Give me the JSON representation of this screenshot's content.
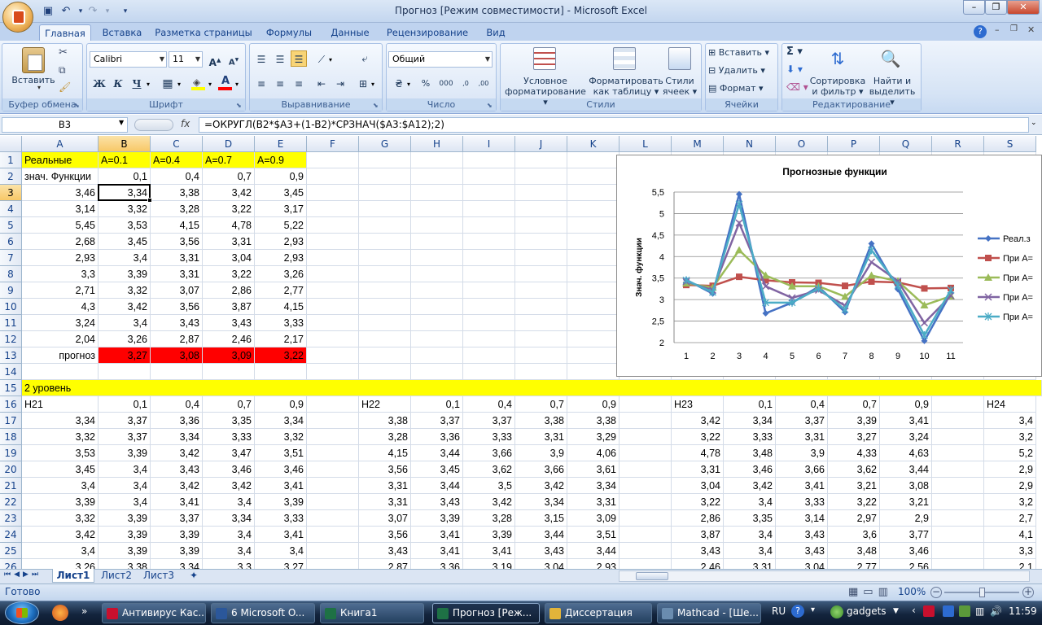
{
  "title": "Прогноз  [Режим совместимости] - Microsoft Excel",
  "ribbon_tabs": [
    "Главная",
    "Вставка",
    "Разметка страницы",
    "Формулы",
    "Данные",
    "Рецензирование",
    "Вид"
  ],
  "groups": {
    "clipboard": {
      "label": "Буфер обмена",
      "paste": "Вставить"
    },
    "font": {
      "label": "Шрифт",
      "name": "Calibri",
      "size": "11"
    },
    "alignment": {
      "label": "Выравнивание"
    },
    "number": {
      "label": "Число",
      "format": "Общий"
    },
    "styles": {
      "label": "Стили",
      "cond1": "Условное",
      "cond2": "форматирование",
      "table1": "Форматировать",
      "table2": "как таблицу",
      "cell1": "Стили",
      "cell2": "ячеек"
    },
    "cells": {
      "label": "Ячейки",
      "insert": "Вставить",
      "delete": "Удалить",
      "format": "Формат"
    },
    "editing": {
      "label": "Редактирование",
      "sort1": "Сортировка",
      "sort2": "и фильтр",
      "find1": "Найти и",
      "find2": "выделить",
      "sigma": "Σ"
    }
  },
  "namebox": "B3",
  "fx": "fx",
  "formula": "=ОКРУГЛ(B2*$A3+(1-B2)*СРЗНАЧ($A3:$A12);2)",
  "columns": [
    "A",
    "B",
    "C",
    "D",
    "E",
    "F",
    "G",
    "H",
    "I",
    "J",
    "K",
    "L",
    "M",
    "N",
    "O",
    "P",
    "Q",
    "R",
    "S"
  ],
  "rows": [
    "1",
    "2",
    "3",
    "4",
    "5",
    "6",
    "7",
    "8",
    "9",
    "10",
    "11",
    "12",
    "13",
    "14",
    "15",
    "16",
    "17",
    "18",
    "19",
    "20",
    "21",
    "22",
    "23",
    "24",
    "25",
    "26"
  ],
  "cells": {
    "r1": [
      "Реальные",
      "A=0.1",
      "A=0.4",
      "A=0.7",
      "A=0.9"
    ],
    "r2": [
      "знач. Функции",
      "0,1",
      "0,4",
      "0,7",
      "0,9"
    ],
    "r3": [
      "3,46",
      "3,34",
      "3,38",
      "3,42",
      "3,45"
    ],
    "r4": [
      "3,14",
      "3,32",
      "3,28",
      "3,22",
      "3,17"
    ],
    "r5": [
      "5,45",
      "3,53",
      "4,15",
      "4,78",
      "5,22"
    ],
    "r6": [
      "2,68",
      "3,45",
      "3,56",
      "3,31",
      "2,93"
    ],
    "r7": [
      "2,93",
      "3,4",
      "3,31",
      "3,04",
      "2,93"
    ],
    "r8": [
      "3,3",
      "3,39",
      "3,31",
      "3,22",
      "3,26"
    ],
    "r9": [
      "2,71",
      "3,32",
      "3,07",
      "2,86",
      "2,77"
    ],
    "r10": [
      "4,3",
      "3,42",
      "3,56",
      "3,87",
      "4,15"
    ],
    "r11": [
      "3,24",
      "3,4",
      "3,43",
      "3,43",
      "3,33"
    ],
    "r12": [
      "2,04",
      "3,26",
      "2,87",
      "2,46",
      "2,17"
    ],
    "r13": [
      "прогноз",
      "3,27",
      "3,08",
      "3,09",
      "3,22"
    ],
    "r15": "2 уровень",
    "r16": [
      "H21",
      "0,1",
      "0,4",
      "0,7",
      "0,9",
      "",
      "H22",
      "0,1",
      "0,4",
      "0,7",
      "0,9",
      "",
      "H23",
      "0,1",
      "0,4",
      "0,7",
      "0,9",
      "",
      "H24"
    ],
    "r17": [
      "3,34",
      "3,37",
      "3,36",
      "3,35",
      "3,34",
      "",
      "3,38",
      "3,37",
      "3,37",
      "3,38",
      "3,38",
      "",
      "3,42",
      "3,34",
      "3,37",
      "3,39",
      "3,41",
      "",
      "3,4"
    ],
    "r18": [
      "3,32",
      "3,37",
      "3,34",
      "3,33",
      "3,32",
      "",
      "3,28",
      "3,36",
      "3,33",
      "3,31",
      "3,29",
      "",
      "3,22",
      "3,33",
      "3,31",
      "3,27",
      "3,24",
      "",
      "3,2"
    ],
    "r19": [
      "3,53",
      "3,39",
      "3,42",
      "3,47",
      "3,51",
      "",
      "4,15",
      "3,44",
      "3,66",
      "3,9",
      "4,06",
      "",
      "4,78",
      "3,48",
      "3,9",
      "4,33",
      "4,63",
      "",
      "5,2"
    ],
    "r20": [
      "3,45",
      "3,4",
      "3,43",
      "3,46",
      "3,46",
      "",
      "3,56",
      "3,45",
      "3,62",
      "3,66",
      "3,61",
      "",
      "3,31",
      "3,46",
      "3,66",
      "3,62",
      "3,44",
      "",
      "2,9"
    ],
    "r21": [
      "3,4",
      "3,4",
      "3,42",
      "3,42",
      "3,41",
      "",
      "3,31",
      "3,44",
      "3,5",
      "3,42",
      "3,34",
      "",
      "3,04",
      "3,42",
      "3,41",
      "3,21",
      "3,08",
      "",
      "2,9"
    ],
    "r22": [
      "3,39",
      "3,4",
      "3,41",
      "3,4",
      "3,39",
      "",
      "3,31",
      "3,43",
      "3,42",
      "3,34",
      "3,31",
      "",
      "3,22",
      "3,4",
      "3,33",
      "3,22",
      "3,21",
      "",
      "3,2"
    ],
    "r23": [
      "3,32",
      "3,39",
      "3,37",
      "3,34",
      "3,33",
      "",
      "3,07",
      "3,39",
      "3,28",
      "3,15",
      "3,09",
      "",
      "2,86",
      "3,35",
      "3,14",
      "2,97",
      "2,9",
      "",
      "2,7"
    ],
    "r24": [
      "3,42",
      "3,39",
      "3,39",
      "3,4",
      "3,41",
      "",
      "3,56",
      "3,41",
      "3,39",
      "3,44",
      "3,51",
      "",
      "3,87",
      "3,4",
      "3,43",
      "3,6",
      "3,77",
      "",
      "4,1"
    ],
    "r25": [
      "3,4",
      "3,39",
      "3,39",
      "3,4",
      "3,4",
      "",
      "3,43",
      "3,41",
      "3,41",
      "3,43",
      "3,44",
      "",
      "3,43",
      "3,4",
      "3,43",
      "3,48",
      "3,46",
      "",
      "3,3"
    ],
    "r26": [
      "3,26",
      "3,38",
      "3,34",
      "3,3",
      "3,27",
      "",
      "2,87",
      "3,36",
      "3,19",
      "3,04",
      "2,93",
      "",
      "2,46",
      "3,31",
      "3,04",
      "2,77",
      "2,56",
      "",
      "2,1"
    ]
  },
  "chart_data": {
    "type": "line",
    "title": "Прогнозные функции",
    "xlabel": "",
    "ylabel": "Знач. функции",
    "categories": [
      "1",
      "2",
      "3",
      "4",
      "5",
      "6",
      "7",
      "8",
      "9",
      "10",
      "11"
    ],
    "ylim": [
      2,
      5.5
    ],
    "yticks": [
      "5,5",
      "5",
      "4,5",
      "4",
      "3,5",
      "3",
      "2,5",
      "2"
    ],
    "grid": true,
    "legend": "right",
    "series": [
      {
        "name": "Реал.з",
        "color": "#4572c4",
        "marker": "diamond",
        "values": [
          3.46,
          3.14,
          5.45,
          2.68,
          2.93,
          3.3,
          2.71,
          4.3,
          3.24,
          2.04,
          3.15
        ]
      },
      {
        "name": "При А=",
        "color": "#c0504d",
        "marker": "square",
        "values": [
          3.34,
          3.32,
          3.53,
          3.45,
          3.4,
          3.39,
          3.32,
          3.42,
          3.4,
          3.26,
          3.27
        ]
      },
      {
        "name": "При А=",
        "color": "#9bbb59",
        "marker": "triangle",
        "values": [
          3.38,
          3.28,
          4.15,
          3.56,
          3.31,
          3.31,
          3.07,
          3.56,
          3.43,
          2.87,
          3.08
        ]
      },
      {
        "name": "При А=",
        "color": "#8064a2",
        "marker": "x",
        "values": [
          3.42,
          3.22,
          4.78,
          3.31,
          3.04,
          3.22,
          2.86,
          3.87,
          3.43,
          2.46,
          3.09
        ]
      },
      {
        "name": "При А=",
        "color": "#4bacc6",
        "marker": "star",
        "values": [
          3.45,
          3.17,
          5.22,
          2.93,
          2.93,
          3.26,
          2.77,
          4.15,
          3.33,
          2.17,
          3.22
        ]
      }
    ]
  },
  "sheets": [
    "Лист1",
    "Лист2",
    "Лист3"
  ],
  "status": "Готово",
  "zoom": "100%",
  "taskbar": {
    "items": [
      "Антивирус Кас...",
      "6 Microsoft O...",
      "Книга1",
      "Прогноз  [Реж...",
      "Диссертация",
      "Mathcad - [Ше..."
    ],
    "lang": "RU",
    "gadgets": "gadgets",
    "time": "11:59"
  },
  "colors": {
    "yellow": "#ffff00",
    "red": "#ff0000",
    "selection": "#f8c867"
  }
}
